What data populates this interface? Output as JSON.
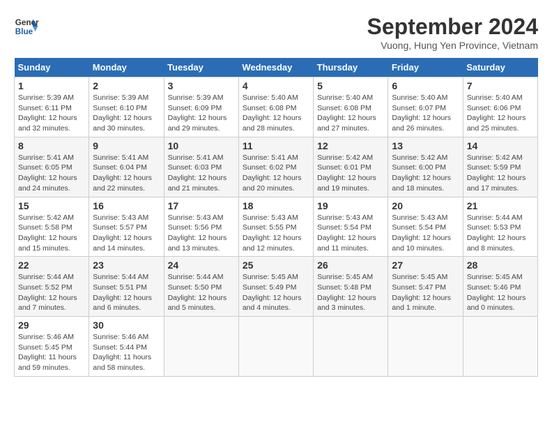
{
  "header": {
    "logo_line1": "General",
    "logo_line2": "Blue",
    "month": "September 2024",
    "location": "Vuong, Hung Yen Province, Vietnam"
  },
  "days_of_week": [
    "Sunday",
    "Monday",
    "Tuesday",
    "Wednesday",
    "Thursday",
    "Friday",
    "Saturday"
  ],
  "weeks": [
    [
      {
        "num": "1",
        "rise": "5:39 AM",
        "set": "6:11 PM",
        "daylight": "12 hours and 32 minutes."
      },
      {
        "num": "2",
        "rise": "5:39 AM",
        "set": "6:10 PM",
        "daylight": "12 hours and 30 minutes."
      },
      {
        "num": "3",
        "rise": "5:39 AM",
        "set": "6:09 PM",
        "daylight": "12 hours and 29 minutes."
      },
      {
        "num": "4",
        "rise": "5:40 AM",
        "set": "6:08 PM",
        "daylight": "12 hours and 28 minutes."
      },
      {
        "num": "5",
        "rise": "5:40 AM",
        "set": "6:08 PM",
        "daylight": "12 hours and 27 minutes."
      },
      {
        "num": "6",
        "rise": "5:40 AM",
        "set": "6:07 PM",
        "daylight": "12 hours and 26 minutes."
      },
      {
        "num": "7",
        "rise": "5:40 AM",
        "set": "6:06 PM",
        "daylight": "12 hours and 25 minutes."
      }
    ],
    [
      {
        "num": "8",
        "rise": "5:41 AM",
        "set": "6:05 PM",
        "daylight": "12 hours and 24 minutes."
      },
      {
        "num": "9",
        "rise": "5:41 AM",
        "set": "6:04 PM",
        "daylight": "12 hours and 22 minutes."
      },
      {
        "num": "10",
        "rise": "5:41 AM",
        "set": "6:03 PM",
        "daylight": "12 hours and 21 minutes."
      },
      {
        "num": "11",
        "rise": "5:41 AM",
        "set": "6:02 PM",
        "daylight": "12 hours and 20 minutes."
      },
      {
        "num": "12",
        "rise": "5:42 AM",
        "set": "6:01 PM",
        "daylight": "12 hours and 19 minutes."
      },
      {
        "num": "13",
        "rise": "5:42 AM",
        "set": "6:00 PM",
        "daylight": "12 hours and 18 minutes."
      },
      {
        "num": "14",
        "rise": "5:42 AM",
        "set": "5:59 PM",
        "daylight": "12 hours and 17 minutes."
      }
    ],
    [
      {
        "num": "15",
        "rise": "5:42 AM",
        "set": "5:58 PM",
        "daylight": "12 hours and 15 minutes."
      },
      {
        "num": "16",
        "rise": "5:43 AM",
        "set": "5:57 PM",
        "daylight": "12 hours and 14 minutes."
      },
      {
        "num": "17",
        "rise": "5:43 AM",
        "set": "5:56 PM",
        "daylight": "12 hours and 13 minutes."
      },
      {
        "num": "18",
        "rise": "5:43 AM",
        "set": "5:55 PM",
        "daylight": "12 hours and 12 minutes."
      },
      {
        "num": "19",
        "rise": "5:43 AM",
        "set": "5:54 PM",
        "daylight": "12 hours and 11 minutes."
      },
      {
        "num": "20",
        "rise": "5:43 AM",
        "set": "5:54 PM",
        "daylight": "12 hours and 10 minutes."
      },
      {
        "num": "21",
        "rise": "5:44 AM",
        "set": "5:53 PM",
        "daylight": "12 hours and 8 minutes."
      }
    ],
    [
      {
        "num": "22",
        "rise": "5:44 AM",
        "set": "5:52 PM",
        "daylight": "12 hours and 7 minutes."
      },
      {
        "num": "23",
        "rise": "5:44 AM",
        "set": "5:51 PM",
        "daylight": "12 hours and 6 minutes."
      },
      {
        "num": "24",
        "rise": "5:44 AM",
        "set": "5:50 PM",
        "daylight": "12 hours and 5 minutes."
      },
      {
        "num": "25",
        "rise": "5:45 AM",
        "set": "5:49 PM",
        "daylight": "12 hours and 4 minutes."
      },
      {
        "num": "26",
        "rise": "5:45 AM",
        "set": "5:48 PM",
        "daylight": "12 hours and 3 minutes."
      },
      {
        "num": "27",
        "rise": "5:45 AM",
        "set": "5:47 PM",
        "daylight": "12 hours and 1 minute."
      },
      {
        "num": "28",
        "rise": "5:45 AM",
        "set": "5:46 PM",
        "daylight": "12 hours and 0 minutes."
      }
    ],
    [
      {
        "num": "29",
        "rise": "5:46 AM",
        "set": "5:45 PM",
        "daylight": "11 hours and 59 minutes."
      },
      {
        "num": "30",
        "rise": "5:46 AM",
        "set": "5:44 PM",
        "daylight": "11 hours and 58 minutes."
      },
      null,
      null,
      null,
      null,
      null
    ]
  ]
}
